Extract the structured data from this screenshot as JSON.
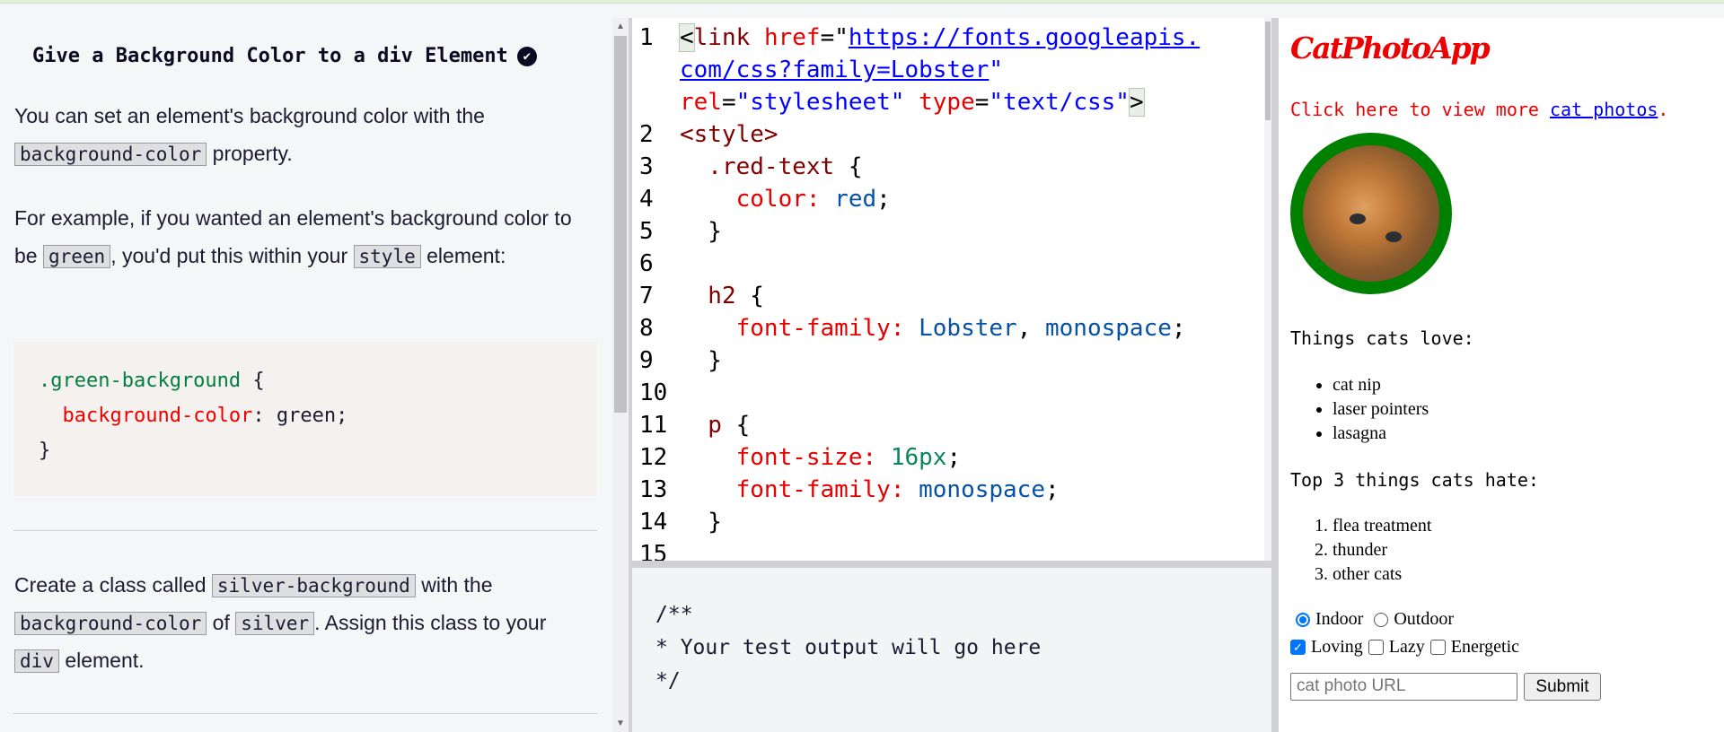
{
  "instructions": {
    "title": "Give a Background Color to a div Element",
    "completed_icon": "check-circle-icon",
    "p1": {
      "t1": "You can set an element's background color with the",
      "c1": "background-color",
      "t2": " property."
    },
    "p2": {
      "t1": "For example, if you wanted an element's background color to be ",
      "c1": "green",
      "t2": ", you'd put this within your ",
      "c2": "style",
      "t3": " element:"
    },
    "example": {
      "selector": ".green-background",
      "brace_open": " {",
      "property": "background-color",
      "value": ": green;",
      "brace_close": "}"
    },
    "p3": {
      "t1": "Create a class called ",
      "c1": "silver-background",
      "t2": " with the ",
      "c2": "background-color",
      "t3": " of ",
      "c3": "silver",
      "t4": ". Assign this class to your ",
      "c4": "div",
      "t5": " element."
    }
  },
  "editor": {
    "lines": [
      {
        "n": "1",
        "tokens": [
          [
            "<",
            "br"
          ],
          [
            "link ",
            "tag"
          ],
          [
            "href",
            "attr"
          ],
          [
            "=\"",
            "plain"
          ],
          [
            "https://fonts.googleapis.",
            "url"
          ]
        ]
      },
      {
        "n": "",
        "tokens": [
          [
            "com/css?family=Lobster",
            "url"
          ],
          [
            "\"",
            "str"
          ]
        ]
      },
      {
        "n": "",
        "tokens": [
          [
            "rel",
            "attr"
          ],
          [
            "=",
            "plain"
          ],
          [
            "\"stylesheet\" ",
            "str"
          ],
          [
            "type",
            "attr"
          ],
          [
            "=",
            "plain"
          ],
          [
            "\"text/css\"",
            "str"
          ],
          [
            ">",
            "br"
          ]
        ]
      },
      {
        "n": "2",
        "tokens": [
          [
            "<style>",
            "tag"
          ]
        ]
      },
      {
        "n": "3",
        "tokens": [
          [
            "  .red-text ",
            "tag"
          ],
          [
            "{",
            "plain"
          ]
        ]
      },
      {
        "n": "4",
        "tokens": [
          [
            "    color: ",
            "prop"
          ],
          [
            "red",
            "val"
          ],
          [
            ";",
            "plain"
          ]
        ]
      },
      {
        "n": "5",
        "tokens": [
          [
            "  }",
            "plain"
          ]
        ]
      },
      {
        "n": "6",
        "tokens": []
      },
      {
        "n": "7",
        "tokens": [
          [
            "  h2 ",
            "tag"
          ],
          [
            "{",
            "plain"
          ]
        ]
      },
      {
        "n": "8",
        "tokens": [
          [
            "    font-family: ",
            "prop"
          ],
          [
            "Lobster",
            "val"
          ],
          [
            ", ",
            "plain"
          ],
          [
            "monospace",
            "val"
          ],
          [
            ";",
            "plain"
          ]
        ]
      },
      {
        "n": "9",
        "tokens": [
          [
            "  }",
            "plain"
          ]
        ]
      },
      {
        "n": "10",
        "tokens": []
      },
      {
        "n": "11",
        "tokens": [
          [
            "  p ",
            "tag"
          ],
          [
            "{",
            "plain"
          ]
        ]
      },
      {
        "n": "12",
        "tokens": [
          [
            "    font-size: ",
            "prop"
          ],
          [
            "16px",
            "num"
          ],
          [
            ";",
            "plain"
          ]
        ]
      },
      {
        "n": "13",
        "tokens": [
          [
            "    font-family: ",
            "prop"
          ],
          [
            "monospace",
            "val"
          ],
          [
            ";",
            "plain"
          ]
        ]
      },
      {
        "n": "14",
        "tokens": [
          [
            "  }",
            "plain"
          ]
        ]
      },
      {
        "n": "15",
        "tokens": []
      }
    ]
  },
  "test_output": "/**\n* Your test output will go here\n*/",
  "preview": {
    "title": "CatPhotoApp",
    "click_text": "Click here to view more ",
    "link_text": "cat photos",
    "period": ".",
    "love_heading": "Things cats love:",
    "love_items": [
      "cat nip",
      "laser pointers",
      "lasagna"
    ],
    "hate_heading": "Top 3 things cats hate:",
    "hate_items": [
      "flea treatment",
      "thunder",
      "other cats"
    ],
    "radio_indoor": "Indoor",
    "radio_outdoor": "Outdoor",
    "cb_loving": "Loving",
    "cb_lazy": "Lazy",
    "cb_energetic": "Energetic",
    "url_placeholder": "cat photo URL",
    "submit": "Submit"
  }
}
